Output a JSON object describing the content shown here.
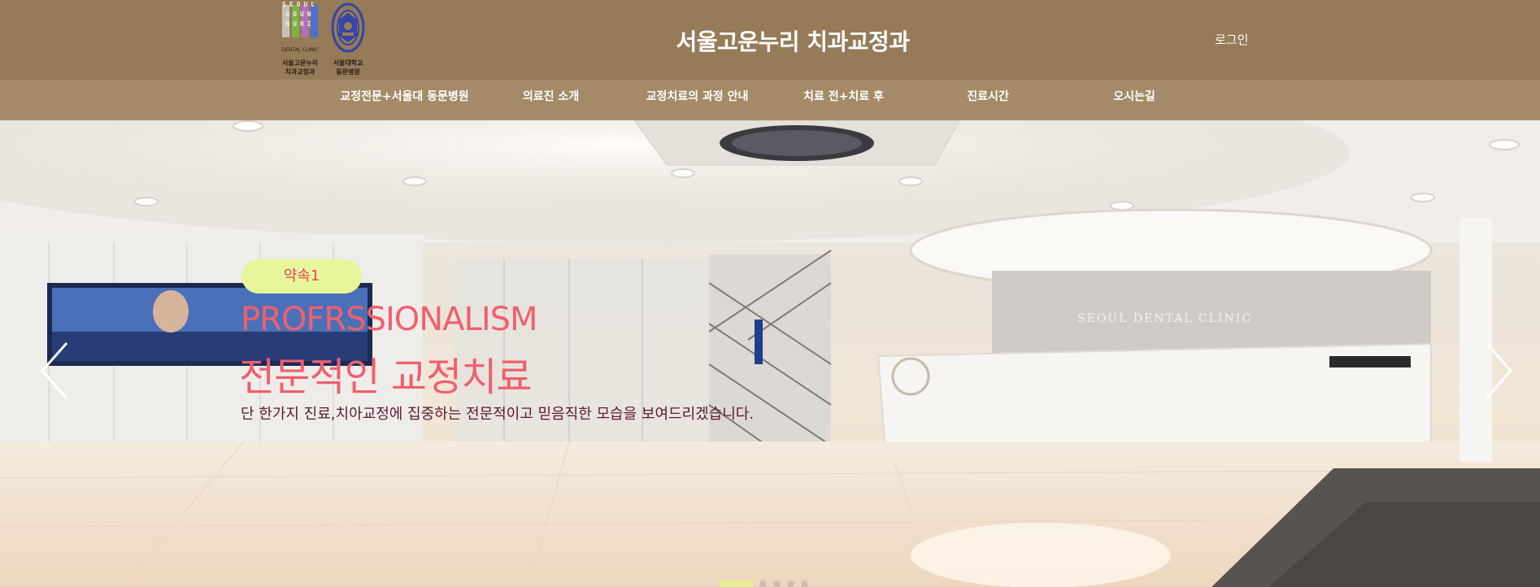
{
  "header": {
    "site_title": "서울고운누리 치과교정과",
    "login_label": "로그인",
    "logo": {
      "letters": "SEOUL GOUN NURI",
      "sub_en": "DENTAL CLINIC",
      "name_kr_line1": "서울고운누리",
      "name_kr_line2": "치과교정과",
      "stripe_colors": [
        "#c8c2b6",
        "#7cb342",
        "#b56fc0",
        "#4c6fd0"
      ],
      "partner_kr_line1": "서울대학교",
      "partner_kr_line2": "동문병원"
    }
  },
  "nav": {
    "items": [
      {
        "label": "교정전문+서울대 동문병원"
      },
      {
        "label": "의료진 소개"
      },
      {
        "label": "교정치료의 과정 안내"
      },
      {
        "label": "치료 전+치료 후"
      },
      {
        "label": "진료시간"
      },
      {
        "label": "오시는길"
      }
    ]
  },
  "hero": {
    "badge": "약속1",
    "title_en": "PROFRSSIONALISM",
    "title_kr": "전문적인 교정치료",
    "description": "단 한가지 진료,치아교정에 집중하는 전문적이고 믿음직한 모습을 보여드리겠습니다.",
    "background_sign": "SEOUL DENTAL CLINIC",
    "slides_total": 5,
    "active_slide": 1
  },
  "colors": {
    "header_bg": "#967b58",
    "nav_bg": "#a58a68",
    "accent_text": "#f0606d",
    "badge_bg": "#e9f59a",
    "desc_text": "#5a1930"
  }
}
